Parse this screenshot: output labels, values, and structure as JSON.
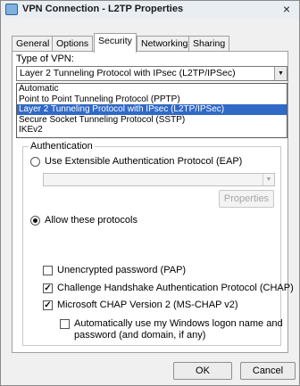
{
  "window": {
    "title": "VPN Connection - L2TP Properties",
    "close_glyph": "×"
  },
  "tabs": [
    "General",
    "Options",
    "Security",
    "Networking",
    "Sharing"
  ],
  "vpn_type": {
    "label": "Type of VPN:",
    "selected": "Layer 2 Tunneling Protocol with IPsec (L2TP/IPSec)",
    "options": [
      "Automatic",
      "Point to Point Tunneling Protocol (PPTP)",
      "Layer 2 Tunneling Protocol with IPsec (L2TP/IPSec)",
      "Secure Socket Tunneling Protocol (SSTP)",
      "IKEv2"
    ]
  },
  "authentication": {
    "legend": "Authentication",
    "eap_label": "Use Extensible Authentication Protocol (EAP)",
    "properties_button": "Properties",
    "allow_label": "Allow these protocols",
    "pap_label": "Unencrypted password (PAP)",
    "chap_label": "Challenge Handshake Authentication Protocol (CHAP)",
    "mschap_label": "Microsoft CHAP Version 2 (MS-CHAP v2)",
    "auto_logon_line1": "Automatically use my Windows logon name and",
    "auto_logon_line2": "password (and domain, if any)",
    "check_glyph": "✓"
  },
  "buttons": {
    "ok": "OK",
    "cancel": "Cancel"
  }
}
